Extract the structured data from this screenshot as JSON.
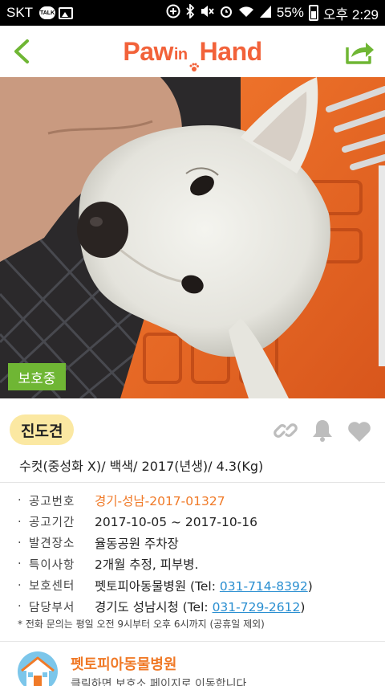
{
  "status_bar": {
    "carrier": "SKT",
    "battery": "55%",
    "time": "오후 2:29",
    "icons": [
      "talk-icon",
      "image-icon",
      "add-circle-icon",
      "bluetooth-icon",
      "mute-icon",
      "alarm-icon",
      "wifi-icon",
      "signal-icon",
      "battery-icon"
    ]
  },
  "header": {
    "logo_left": "Paw",
    "logo_mid": "in",
    "logo_right": "Hand",
    "colors": {
      "logo": "#f2623a",
      "icons": "#6fb634"
    }
  },
  "photo": {
    "status_badge": "보호중",
    "badge_color": "#6fb634"
  },
  "animal": {
    "breed": "진도견",
    "summary": "수컷(중성화 X)/ 백색/ 2017(년생)/ 4.3(Kg)"
  },
  "details": [
    {
      "label": "공고번호",
      "value": "경기-성남-2017-01327"
    },
    {
      "label": "공고기간",
      "value": "2017-10-05 ~ 2017-10-16"
    },
    {
      "label": "발견장소",
      "value": "율동공원 주차장"
    },
    {
      "label": "특이사항",
      "value": "2개월 추정, 피부병."
    },
    {
      "label": "보호센터",
      "value": "펫토피아동물병원 (Tel: ",
      "tel": "031-714-8392",
      "close": ")"
    },
    {
      "label": "담당부서",
      "value": "경기도 성남시청 (Tel: ",
      "tel": "031-729-2612",
      "close": ")"
    }
  ],
  "note": "* 전화 문의는 평일 오전 9시부터 오후 6시까지 (공휴일 제외)",
  "shelter_card": {
    "name": "펫토피아동물병원",
    "subtitle": "클릭하면 보호소 페이지로 이동합니다"
  }
}
